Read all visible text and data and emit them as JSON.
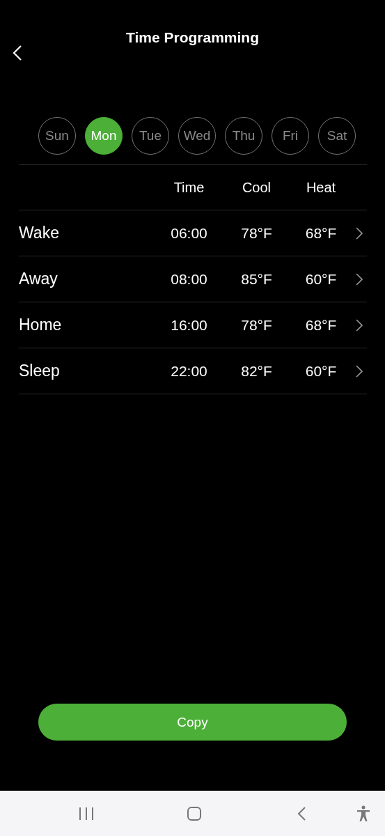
{
  "header": {
    "title": "Time Programming"
  },
  "days": [
    {
      "label": "Sun",
      "selected": false
    },
    {
      "label": "Mon",
      "selected": true
    },
    {
      "label": "Tue",
      "selected": false
    },
    {
      "label": "Wed",
      "selected": false
    },
    {
      "label": "Thu",
      "selected": false
    },
    {
      "label": "Fri",
      "selected": false
    },
    {
      "label": "Sat",
      "selected": false
    }
  ],
  "table": {
    "columns": [
      "Time",
      "Cool",
      "Heat"
    ],
    "rows": [
      {
        "name": "Wake",
        "time": "06:00",
        "cool": "78°F",
        "heat": "68°F"
      },
      {
        "name": "Away",
        "time": "08:00",
        "cool": "85°F",
        "heat": "60°F"
      },
      {
        "name": "Home",
        "time": "16:00",
        "cool": "78°F",
        "heat": "68°F"
      },
      {
        "name": "Sleep",
        "time": "22:00",
        "cool": "82°F",
        "heat": "60°F"
      }
    ]
  },
  "copy_button": {
    "label": "Copy"
  }
}
